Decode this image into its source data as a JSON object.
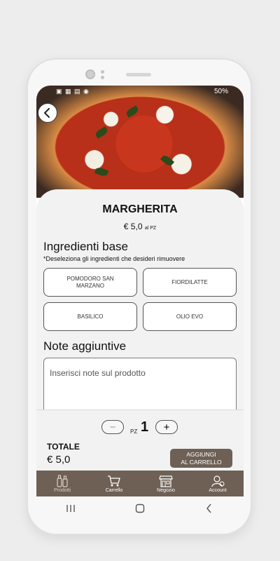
{
  "status_bar": {
    "battery": "50%"
  },
  "product": {
    "name": "MARGHERITA",
    "price": "€ 5,0",
    "price_unit": "al PZ"
  },
  "ingredients": {
    "title": "Ingredienti base",
    "hint": "*Deseleziona gli ingredienti che desideri rimuovere",
    "items": [
      "POMODORO SAN MARZANO",
      "FIORDILATTE",
      "BASILICO",
      "OLIO EVO"
    ]
  },
  "notes": {
    "title": "Note aggiuntive",
    "placeholder": "Inserisci note sul prodotto",
    "value": ""
  },
  "quantity": {
    "minus": "−",
    "plus": "+",
    "unit": "PZ",
    "value": "1"
  },
  "total": {
    "label": "TOTALE",
    "value": "€ 5,0"
  },
  "add_to_cart": {
    "line1": "AGGIUNGI",
    "line2": "AL CARRELLO"
  },
  "tabbar": {
    "items": [
      {
        "label": "Prodotti",
        "icon": "bottles-icon",
        "active": true
      },
      {
        "label": "Carrello",
        "icon": "cart-icon",
        "active": false
      },
      {
        "label": "Negozio",
        "icon": "store-icon",
        "active": false
      },
      {
        "label": "Account",
        "icon": "account-icon",
        "active": false
      }
    ]
  },
  "colors": {
    "accent": "#6e6055",
    "panel": "#f2f2f2"
  }
}
